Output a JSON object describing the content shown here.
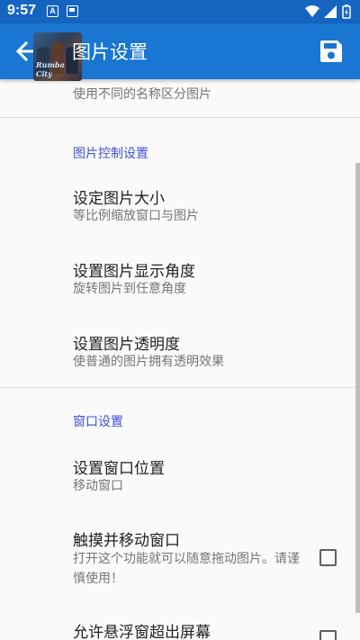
{
  "status_bar": {
    "time": "9:57",
    "notif_a": "A"
  },
  "app_bar": {
    "title": "图片设置",
    "app_icon_text": "Rumba City",
    "back_icon": "arrow-left-icon",
    "save_icon": "floppy-disk-icon"
  },
  "colors": {
    "status_bar": "#1565c0",
    "app_bar": "#1976d2",
    "category_text": "#3f51d6",
    "summary_text": "#757575"
  },
  "top_partial": {
    "summary": "使用不同的名称区分图片"
  },
  "categories": [
    {
      "title": "图片控制设置",
      "items": [
        {
          "title": "设定图片大小",
          "summary": "等比例缩放窗口与图片"
        },
        {
          "title": "设置图片显示角度",
          "summary": "旋转图片到任意角度"
        },
        {
          "title": "设置图片透明度",
          "summary": "使普通的图片拥有透明效果"
        }
      ]
    },
    {
      "title": "窗口设置",
      "items": [
        {
          "title": "设置窗口位置",
          "summary": "移动窗口"
        },
        {
          "title": "触摸并移动窗口",
          "summary": "打开这个功能就可以随意拖动图片。请谨慎使用！",
          "checkbox": false
        },
        {
          "title": "允许悬浮窗超出屏幕",
          "summary": "",
          "checkbox": false
        }
      ]
    }
  ]
}
